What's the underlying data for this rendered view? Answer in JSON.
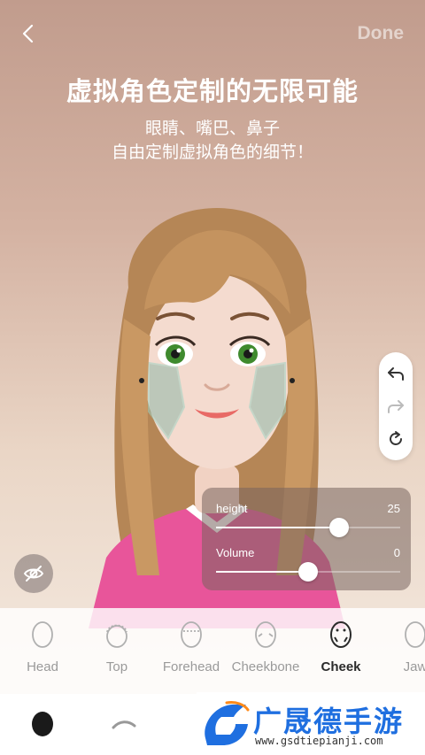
{
  "header": {
    "back_label": "‹",
    "done_label": "Done"
  },
  "promo": {
    "title": "虚拟角色定制的无限可能",
    "subtitle_line1": "眼睛、嘴巴、鼻子",
    "subtitle_line2": "自由定制虚拟角色的细节！"
  },
  "side_tools": [
    "undo-icon",
    "redo-icon",
    "reset-icon"
  ],
  "sliders": [
    {
      "label": "height",
      "value": "25",
      "fraction": 0.67
    },
    {
      "label": "Volume",
      "value": "0",
      "fraction": 0.5
    }
  ],
  "parts": [
    {
      "label": "Head",
      "active": false
    },
    {
      "label": "Top",
      "active": false
    },
    {
      "label": "Forehead",
      "active": false
    },
    {
      "label": "Cheekbone",
      "active": false
    },
    {
      "label": "Cheek",
      "active": true
    },
    {
      "label": "Jaw",
      "active": false
    }
  ],
  "bottom_tabs": [
    "face-shape-icon",
    "eyebrow-icon"
  ],
  "watermark": {
    "name": "广晟德手游",
    "url": "www.gsdtiepianji.com"
  },
  "colors": {
    "accent": "#1f6fe0",
    "sweater": "#e8559a",
    "hair": "#b7875c"
  }
}
